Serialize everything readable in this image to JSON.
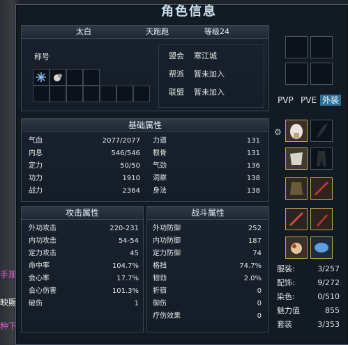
{
  "window": {
    "title": "角色信息"
  },
  "left_edge": [
    "手那方",
    "映賜",
    "种下"
  ],
  "header": {
    "name": "太白",
    "level_text": "天跑跑",
    "grade": "等级24"
  },
  "identity": {
    "title_label": "称号",
    "alliance_label": "盟会",
    "alliance_value": "寒江城",
    "sect_label": "帮派",
    "sect_value": "暂未加入",
    "union_label": "联盟",
    "union_value": "暂未加入"
  },
  "base_attrs": {
    "title": "基础属性",
    "left": [
      {
        "label": "气血",
        "value": "2077/2077"
      },
      {
        "label": "内息",
        "value": "546/546"
      },
      {
        "label": "定力",
        "value": "50/50"
      },
      {
        "label": "功力",
        "value": "1910"
      },
      {
        "label": "战力",
        "value": "2364"
      }
    ],
    "right": [
      {
        "label": "力道",
        "value": "131"
      },
      {
        "label": "根骨",
        "value": "131"
      },
      {
        "label": "气劲",
        "value": "136"
      },
      {
        "label": "洞察",
        "value": "138"
      },
      {
        "label": "身法",
        "value": "138"
      }
    ]
  },
  "attack_attrs": {
    "title": "攻击属性",
    "rows": [
      {
        "label": "外功攻击",
        "value": "220-231"
      },
      {
        "label": "内功攻击",
        "value": "54-54"
      },
      {
        "label": "定力攻击",
        "value": "45"
      },
      {
        "label": "命中率",
        "value": "104.7%"
      },
      {
        "label": "会心率",
        "value": "17.7%"
      },
      {
        "label": "会心伤害",
        "value": "101.3%"
      },
      {
        "label": "破伤",
        "value": "1"
      }
    ]
  },
  "combat_attrs": {
    "title": "战斗属性",
    "rows": [
      {
        "label": "外功防御",
        "value": "252"
      },
      {
        "label": "内功防御",
        "value": "187"
      },
      {
        "label": "定力防御",
        "value": "74"
      },
      {
        "label": "格挡",
        "value": "74.7%"
      },
      {
        "label": "韧劲",
        "value": "2.0%"
      },
      {
        "label": "折宿",
        "value": "0"
      },
      {
        "label": "御伤",
        "value": "0"
      },
      {
        "label": "疗伤效果",
        "value": "0"
      }
    ]
  },
  "tabs": {
    "pvp": "PVP",
    "pve": "PVE",
    "outfit": "外装"
  },
  "stats": [
    {
      "label": "服装:",
      "value": "3/257"
    },
    {
      "label": "配饰:",
      "value": "9/272"
    },
    {
      "label": "染色:",
      "value": "0/510"
    },
    {
      "label": "魅力值",
      "value": "855"
    },
    {
      "label": "套装",
      "value": "3/353"
    }
  ],
  "colors": {
    "accent": "#2e6f95",
    "gold_frame": "#c7a44a",
    "panel_border": "#3a4755"
  }
}
